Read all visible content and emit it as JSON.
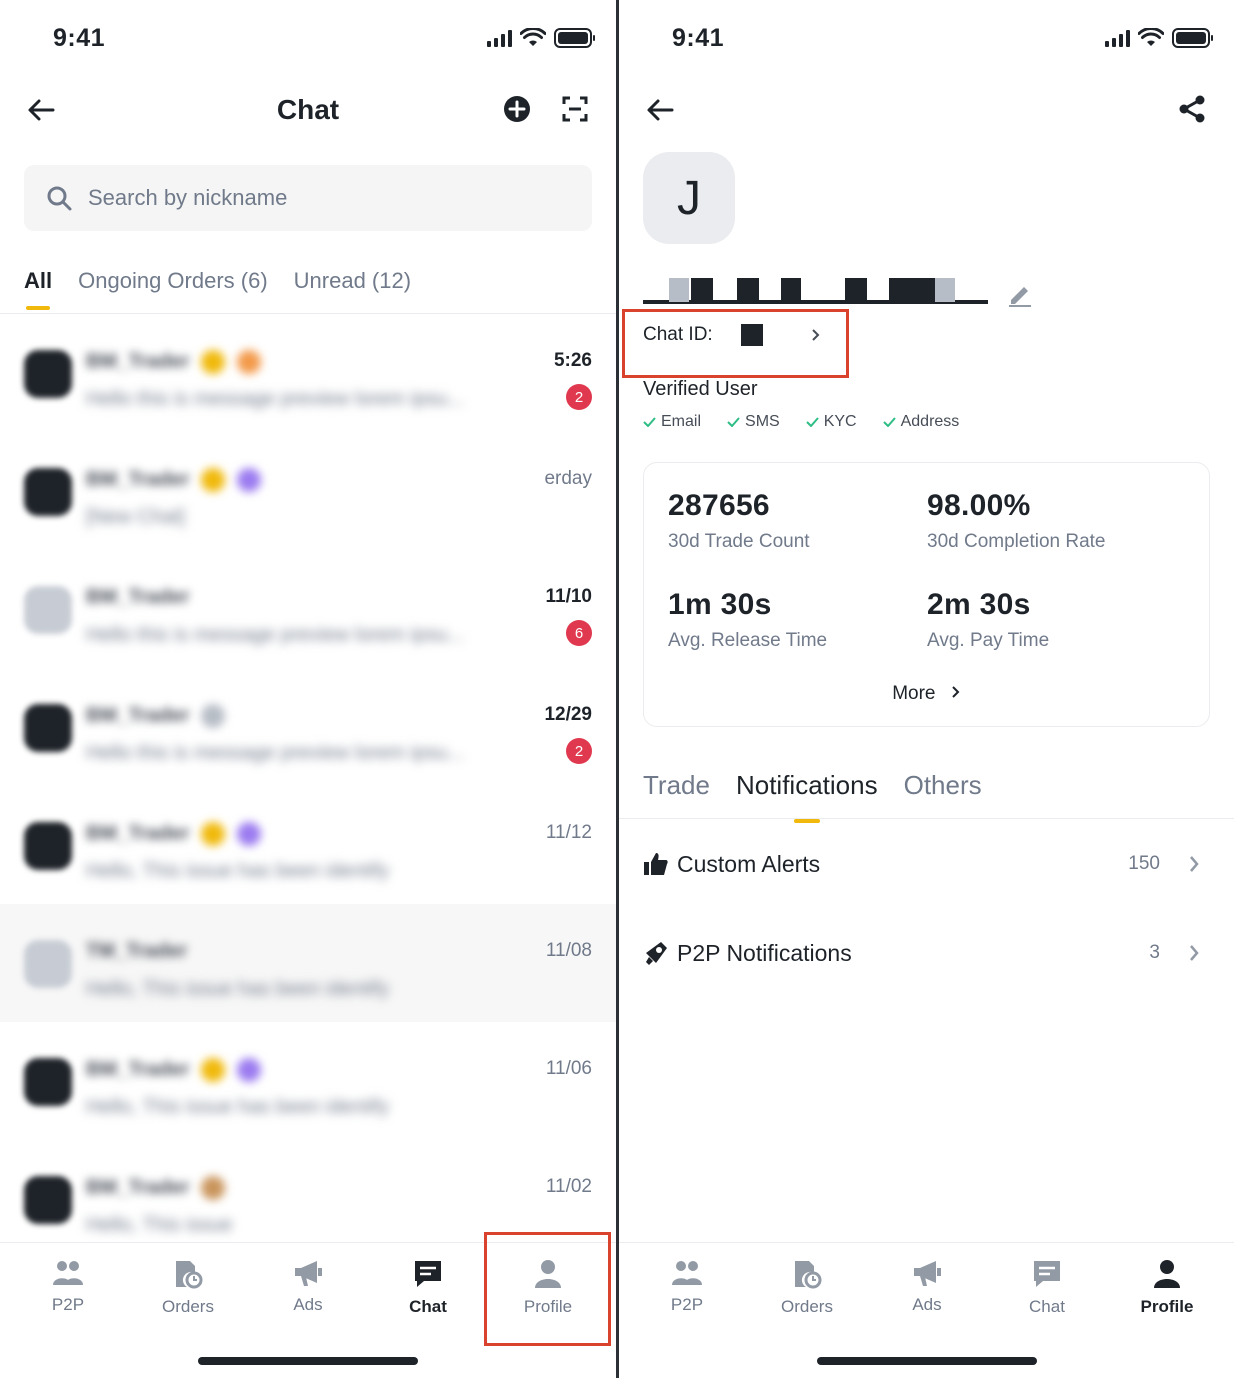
{
  "left": {
    "status": {
      "time": "9:41"
    },
    "header": {
      "title": "Chat"
    },
    "search": {
      "placeholder": "Search by nickname"
    },
    "tabs": [
      {
        "label": "All",
        "active": true
      },
      {
        "label": "Ongoing Orders (6)"
      },
      {
        "label": "Unread (12)"
      }
    ],
    "chats": [
      {
        "time": "5:26",
        "unread": "2"
      },
      {
        "time": "erday",
        "unread": ""
      },
      {
        "time": "11/10",
        "unread": "6"
      },
      {
        "time": "12/29",
        "unread": "2"
      },
      {
        "time": "11/12",
        "unread": ""
      },
      {
        "time": "11/08",
        "unread": ""
      },
      {
        "time": "11/06",
        "unread": ""
      },
      {
        "time": "11/02",
        "unread": ""
      }
    ],
    "nav": [
      {
        "label": "P2P",
        "icon": "p2p-icon"
      },
      {
        "label": "Orders",
        "icon": "orders-icon"
      },
      {
        "label": "Ads",
        "icon": "ads-icon"
      },
      {
        "label": "Chat",
        "icon": "chat-icon",
        "active": true
      },
      {
        "label": "Profile",
        "icon": "profile-icon"
      }
    ]
  },
  "right": {
    "status": {
      "time": "9:41"
    },
    "profile": {
      "avatar_letter": "J",
      "chat_id_label": "Chat ID:",
      "verified_label": "Verified User",
      "verifications": [
        "Email",
        "SMS",
        "KYC",
        "Address"
      ]
    },
    "stats": [
      {
        "value": "287656",
        "label": "30d Trade Count"
      },
      {
        "value": "98.00%",
        "label": "30d Completion Rate"
      },
      {
        "value": "1m 30s",
        "label": "Avg. Release Time"
      },
      {
        "value": "2m 30s",
        "label": "Avg. Pay Time"
      }
    ],
    "more_label": "More",
    "tabs": [
      {
        "label": "Trade"
      },
      {
        "label": "Notifications",
        "active": true
      },
      {
        "label": "Others"
      }
    ],
    "notification_rows": [
      {
        "label": "Custom Alerts",
        "count": "150",
        "icon": "thumbs-up-icon"
      },
      {
        "label": "P2P Notifications",
        "count": "3",
        "icon": "megaphone-icon"
      }
    ],
    "nav": [
      {
        "label": "P2P",
        "icon": "p2p-icon"
      },
      {
        "label": "Orders",
        "icon": "orders-icon"
      },
      {
        "label": "Ads",
        "icon": "ads-icon"
      },
      {
        "label": "Chat",
        "icon": "chat-icon"
      },
      {
        "label": "Profile",
        "icon": "profile-icon",
        "active": true
      }
    ]
  },
  "colors": {
    "accent": "#f0b90b",
    "text_primary": "#1e2329",
    "text_secondary": "#707a8a",
    "badge_red": "#e0394f",
    "highlight_red": "#d9432e",
    "check_green": "#2ebd85"
  }
}
